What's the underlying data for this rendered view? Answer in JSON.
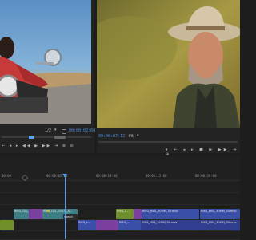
{
  "source_monitor": {
    "zoom": "1/2",
    "timecode": "00:00:02:04",
    "image_description": "rider on vintage motorcycle"
  },
  "program_monitor": {
    "timecode": "00:00:07:12",
    "zoom": "Fit",
    "image_description": "man in straw hat portrait"
  },
  "timeline": {
    "ruler_labels": [
      "00:00",
      "00:00:05:00",
      "00:00:10:00",
      "00:00:15:00",
      "00:00:20:00"
    ],
    "clips_v2": [
      {
        "label": "RMG_CEL_0..."
      },
      {
        "label": "RMG_CEL_00073_0..."
      },
      {
        "label": "RMG_C..."
      },
      {
        "label": "RMG_MSS_30MM_30.mov"
      },
      {
        "label": "RMG_MSS_30MM_30.mov"
      }
    ],
    "clips_v1": [
      {
        "label": "speed"
      },
      {
        "label": "RMG_L..."
      },
      {
        "label": "RMG_..."
      },
      {
        "label": "RMG_MSS_30MM_30.mov"
      },
      {
        "label": "RMG_MSS_30MM_30.mov"
      }
    ]
  },
  "colors": {
    "accent": "#4a8fe0",
    "clip_purple": "#7b3fa0",
    "clip_teal": "#3e7f86",
    "clip_blue": "#3a4fa8",
    "clip_green": "#6f8f2a"
  }
}
